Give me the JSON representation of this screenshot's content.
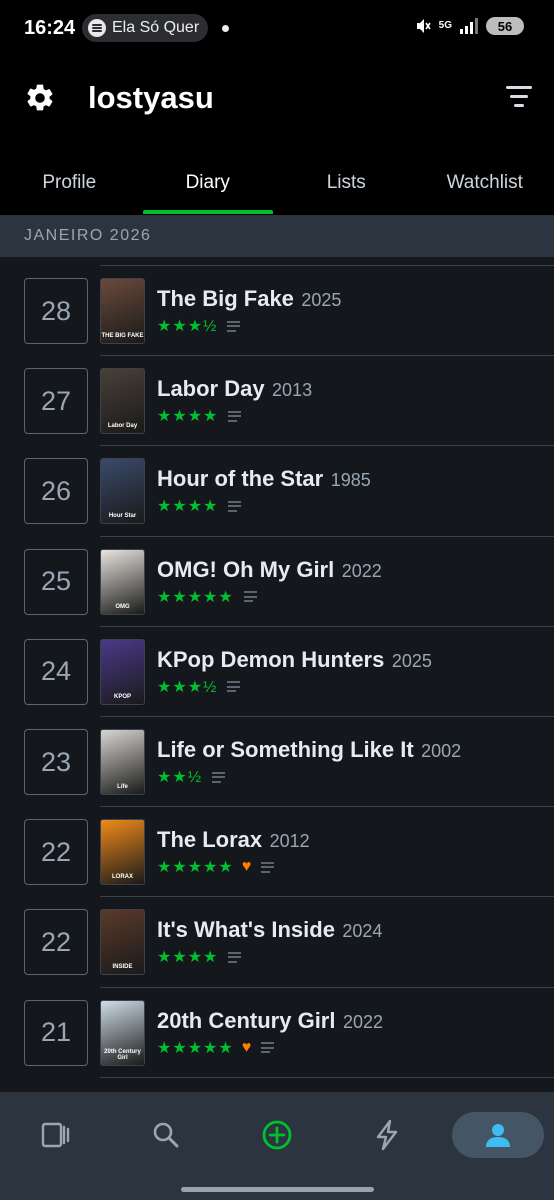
{
  "status_bar": {
    "time": "16:24",
    "now_playing": "Ela Só Quer",
    "network": "5G",
    "battery": "56"
  },
  "header": {
    "username": "lostyasu"
  },
  "tabs": [
    {
      "label": "Profile",
      "active": false
    },
    {
      "label": "Diary",
      "active": true
    },
    {
      "label": "Lists",
      "active": false
    },
    {
      "label": "Watchlist",
      "active": false
    }
  ],
  "month_header": "JANEIRO 2026",
  "entries": [
    {
      "day": "28",
      "title": "The Big Fake",
      "year": "2025",
      "rating": "★★★½",
      "liked": false,
      "poster_text": "THE BIG FAKE",
      "poster_color": "#6b4a3a"
    },
    {
      "day": "27",
      "title": "Labor Day",
      "year": "2013",
      "rating": "★★★★",
      "liked": false,
      "poster_text": "Labor Day",
      "poster_color": "#4a4038"
    },
    {
      "day": "26",
      "title": "Hour of the Star",
      "year": "1985",
      "rating": "★★★★",
      "liked": false,
      "poster_text": "Hour Star",
      "poster_color": "#3a4a6a"
    },
    {
      "day": "25",
      "title": "OMG! Oh My Girl",
      "year": "2022",
      "rating": "★★★★★",
      "liked": false,
      "poster_text": "OMG",
      "poster_color": "#e8e4de"
    },
    {
      "day": "24",
      "title": "KPop Demon Hunters",
      "year": "2025",
      "rating": "★★★½",
      "liked": false,
      "poster_text": "KPOP",
      "poster_color": "#4a3a8a"
    },
    {
      "day": "23",
      "title": "Life or Something Like It",
      "year": "2002",
      "rating": "★★½",
      "liked": false,
      "poster_text": "Life",
      "poster_color": "#d8d6d0"
    },
    {
      "day": "22",
      "title": "The Lorax",
      "year": "2012",
      "rating": "★★★★★",
      "liked": true,
      "poster_text": "LORAX",
      "poster_color": "#f08a1a"
    },
    {
      "day": "22",
      "title": "It's What's Inside",
      "year": "2024",
      "rating": "★★★★",
      "liked": false,
      "poster_text": "INSIDE",
      "poster_color": "#5a3a2a"
    },
    {
      "day": "21",
      "title": "20th Century Girl",
      "year": "2022",
      "rating": "★★★★★",
      "liked": true,
      "poster_text": "20th Century Girl",
      "poster_color": "#d0dce6"
    }
  ],
  "bottom_nav": [
    {
      "icon": "films-icon",
      "active": false
    },
    {
      "icon": "search-icon",
      "active": false
    },
    {
      "icon": "add-log-icon",
      "active": false
    },
    {
      "icon": "activity-icon",
      "active": false
    },
    {
      "icon": "profile-icon",
      "active": true
    }
  ],
  "colors": {
    "accent_green": "#00c030",
    "like_orange": "#ff8000",
    "background": "#14181c",
    "month_bar": "#2c3440"
  }
}
